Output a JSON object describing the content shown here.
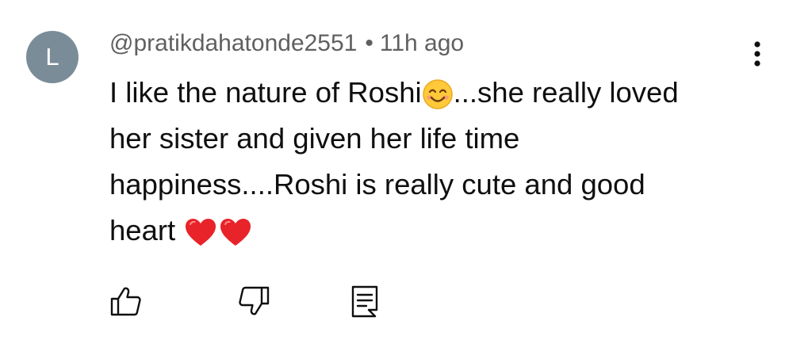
{
  "comment": {
    "avatar_letter": "L",
    "avatar_color": "#7a8c97",
    "username": "@pratikdahatonde2551",
    "separator": "•",
    "time": "11h ago",
    "text": {
      "part1": "I like the nature of Roshi",
      "emoji1": "smiling-face-emoji",
      "part2": "...she really loved\nher sister  and given her life time\nhappiness....Roshi is really cute and good\nheart ",
      "emoji2": "red-heart-emoji",
      "emoji3": "red-heart-emoji"
    }
  },
  "actions": {
    "like_icon": "thumbs-up-icon",
    "dislike_icon": "thumbs-down-icon",
    "reply_icon": "reply-comment-icon",
    "more_icon": "more-vertical-icon"
  }
}
